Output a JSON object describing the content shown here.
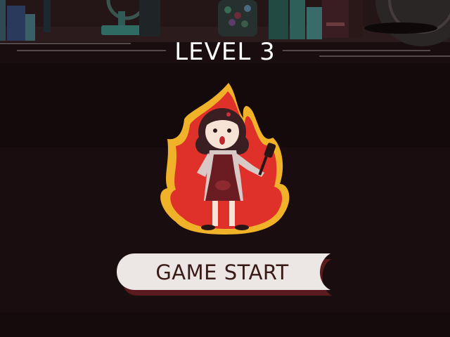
{
  "level": {
    "title": "LEVEL 3"
  },
  "start_button": {
    "label": "GAME START"
  },
  "colors": {
    "background": "#1a0d0f",
    "fire_outer": "#f0b229",
    "fire_inner": "#e0302a",
    "button_face": "#ece6e4",
    "button_shadow": "#5a1a1e",
    "text": "#ffffff"
  }
}
